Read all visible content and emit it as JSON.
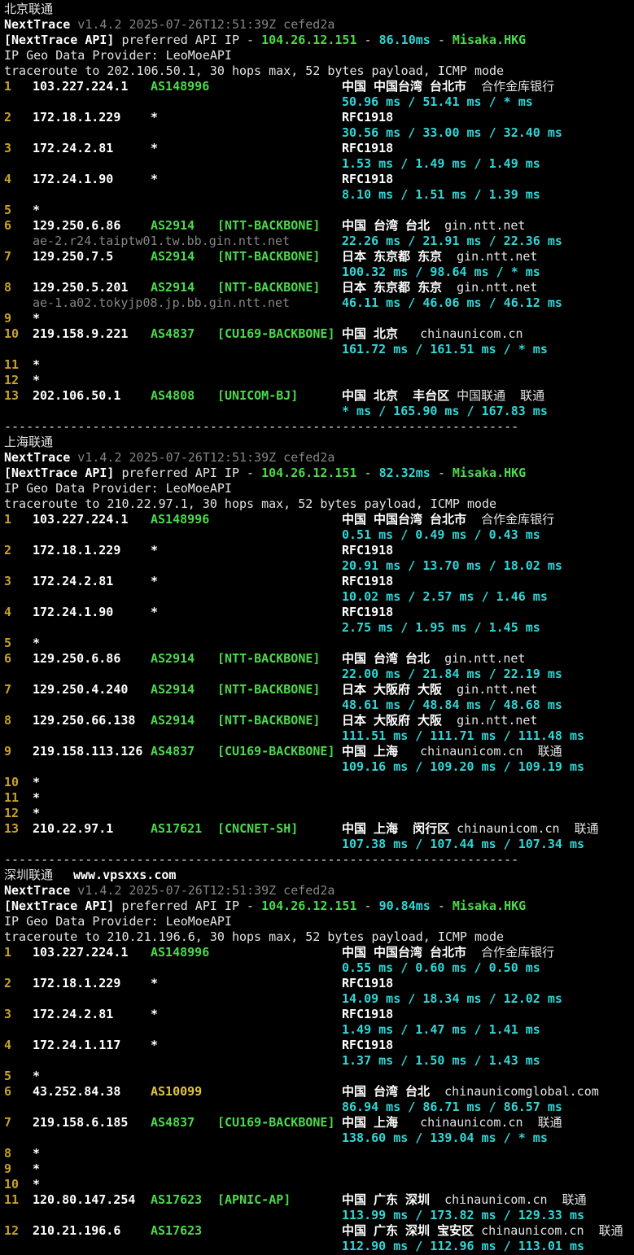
{
  "palette": {
    "background": "#000000",
    "text": "#e4e4e4",
    "text_bold": "#ffffff",
    "green": "#4cda4c",
    "cyan": "#31d6d6",
    "yellow": "#c9a22a",
    "yellow_bright": "#e2c53a",
    "gray": "#858585"
  },
  "sections": [
    {
      "title": "北京联通",
      "watermark": "",
      "app_name": "NextTrace",
      "version": " v1.4.2 2025-07-26T12:51:39Z cefed2a",
      "api": {
        "label": "[NextTrace API]",
        "pre": " preferred API IP - ",
        "ip": "104.26.12.151",
        "sep1": " - ",
        "latency": "86.10ms",
        "sep2": " - ",
        "node": "Misaka.HKG"
      },
      "provider_line": "IP Geo Data Provider: LeoMoeAPI",
      "trace_line": "traceroute to 202.106.50.1, 30 hops max, 52 bytes payload, ICMP mode",
      "separator": "----------------------------------------------------------------------",
      "hops": [
        {
          "n": "1",
          "ip": "103.227.224.1",
          "asn": "AS148996",
          "asn_c": "g",
          "tag": "",
          "loc": [
            {
              "t": "中国 中国台湾 台北市",
              "s": "b"
            },
            {
              "t": "  合作金库银行",
              "s": "w"
            }
          ],
          "host": "",
          "lat": "50.96 ms / 51.41 ms / * ms"
        },
        {
          "n": "2",
          "ip": "172.18.1.229",
          "asn": "*",
          "asn_c": "b",
          "tag": "",
          "loc": [
            {
              "t": "RFC1918",
              "s": "b"
            }
          ],
          "host": "",
          "lat": "30.56 ms / 33.00 ms / 32.40 ms"
        },
        {
          "n": "3",
          "ip": "172.24.2.81",
          "asn": "*",
          "asn_c": "b",
          "tag": "",
          "loc": [
            {
              "t": "RFC1918",
              "s": "b"
            }
          ],
          "host": "",
          "lat": "1.53 ms / 1.49 ms / 1.49 ms"
        },
        {
          "n": "4",
          "ip": "172.24.1.90",
          "asn": "*",
          "asn_c": "b",
          "tag": "",
          "loc": [
            {
              "t": "RFC1918",
              "s": "b"
            }
          ],
          "host": "",
          "lat": "8.10 ms / 1.51 ms / 1.39 ms"
        },
        {
          "n": "5",
          "ip": "*"
        },
        {
          "n": "6",
          "ip": "129.250.6.86",
          "asn": "AS2914",
          "asn_c": "g",
          "tag": "[NTT-BACKBONE]",
          "loc": [
            {
              "t": "中国 台湾 台北",
              "s": "b"
            },
            {
              "t": "  gin.ntt.net",
              "s": "w"
            }
          ],
          "host": "ae-2.r24.taiptw01.tw.bb.gin.ntt.net",
          "lat": "22.26 ms / 21.91 ms / 22.36 ms"
        },
        {
          "n": "7",
          "ip": "129.250.7.5",
          "asn": "AS2914",
          "asn_c": "g",
          "tag": "[NTT-BACKBONE]",
          "loc": [
            {
              "t": "日本 东京都 东京",
              "s": "b"
            },
            {
              "t": "  gin.ntt.net",
              "s": "w"
            }
          ],
          "host": "",
          "lat": "100.32 ms / 98.64 ms / * ms"
        },
        {
          "n": "8",
          "ip": "129.250.5.201",
          "asn": "AS2914",
          "asn_c": "g",
          "tag": "[NTT-BACKBONE]",
          "loc": [
            {
              "t": "日本 东京都 东京",
              "s": "b"
            },
            {
              "t": "  gin.ntt.net",
              "s": "w"
            }
          ],
          "host": "ae-1.a02.tokyjp08.jp.bb.gin.ntt.net",
          "lat": "46.11 ms / 46.06 ms / 46.12 ms"
        },
        {
          "n": "9",
          "ip": "*"
        },
        {
          "n": "10",
          "ip": "219.158.9.221",
          "asn": "AS4837",
          "asn_c": "g",
          "tag": "[CU169-BACKBONE]",
          "loc": [
            {
              "t": "中国 北京",
              "s": "b"
            },
            {
              "t": "   chinaunicom.cn",
              "s": "w"
            }
          ],
          "host": "",
          "lat": "161.72 ms / 161.51 ms / * ms"
        },
        {
          "n": "11",
          "ip": "*"
        },
        {
          "n": "12",
          "ip": "*"
        },
        {
          "n": "13",
          "ip": "202.106.50.1",
          "asn": "AS4808",
          "asn_c": "g",
          "tag": "[UNICOM-BJ]",
          "loc": [
            {
              "t": "中国 北京  丰台区",
              "s": "b"
            },
            {
              "t": " 中国联通  联通",
              "s": "w"
            }
          ],
          "host": "",
          "lat": "* ms / 165.90 ms / 167.83 ms"
        }
      ]
    },
    {
      "title": "上海联通",
      "watermark": "",
      "app_name": "NextTrace",
      "version": " v1.4.2 2025-07-26T12:51:39Z cefed2a",
      "api": {
        "label": "[NextTrace API]",
        "pre": " preferred API IP - ",
        "ip": "104.26.12.151",
        "sep1": " - ",
        "latency": "82.32ms",
        "sep2": " - ",
        "node": "Misaka.HKG"
      },
      "provider_line": "IP Geo Data Provider: LeoMoeAPI",
      "trace_line": "traceroute to 210.22.97.1, 30 hops max, 52 bytes payload, ICMP mode",
      "separator": "----------------------------------------------------------------------",
      "hops": [
        {
          "n": "1",
          "ip": "103.227.224.1",
          "asn": "AS148996",
          "asn_c": "g",
          "tag": "",
          "loc": [
            {
              "t": "中国 中国台湾 台北市",
              "s": "b"
            },
            {
              "t": "  合作金库银行",
              "s": "w"
            }
          ],
          "host": "",
          "lat": "0.51 ms / 0.49 ms / 0.43 ms"
        },
        {
          "n": "2",
          "ip": "172.18.1.229",
          "asn": "*",
          "asn_c": "b",
          "tag": "",
          "loc": [
            {
              "t": "RFC1918",
              "s": "b"
            }
          ],
          "host": "",
          "lat": "20.91 ms / 13.70 ms / 18.02 ms"
        },
        {
          "n": "3",
          "ip": "172.24.2.81",
          "asn": "*",
          "asn_c": "b",
          "tag": "",
          "loc": [
            {
              "t": "RFC1918",
              "s": "b"
            }
          ],
          "host": "",
          "lat": "10.02 ms / 2.57 ms / 1.46 ms"
        },
        {
          "n": "4",
          "ip": "172.24.1.90",
          "asn": "*",
          "asn_c": "b",
          "tag": "",
          "loc": [
            {
              "t": "RFC1918",
              "s": "b"
            }
          ],
          "host": "",
          "lat": "2.75 ms / 1.95 ms / 1.45 ms"
        },
        {
          "n": "5",
          "ip": "*"
        },
        {
          "n": "6",
          "ip": "129.250.6.86",
          "asn": "AS2914",
          "asn_c": "g",
          "tag": "[NTT-BACKBONE]",
          "loc": [
            {
              "t": "中国 台湾 台北",
              "s": "b"
            },
            {
              "t": "  gin.ntt.net",
              "s": "w"
            }
          ],
          "host": "",
          "lat": "22.00 ms / 21.84 ms / 22.19 ms"
        },
        {
          "n": "7",
          "ip": "129.250.4.240",
          "asn": "AS2914",
          "asn_c": "g",
          "tag": "[NTT-BACKBONE]",
          "loc": [
            {
              "t": "日本 大阪府 大阪",
              "s": "b"
            },
            {
              "t": "  gin.ntt.net",
              "s": "w"
            }
          ],
          "host": "",
          "lat": "48.61 ms / 48.84 ms / 48.68 ms"
        },
        {
          "n": "8",
          "ip": "129.250.66.138",
          "asn": "AS2914",
          "asn_c": "g",
          "tag": "[NTT-BACKBONE]",
          "loc": [
            {
              "t": "日本 大阪府 大阪",
              "s": "b"
            },
            {
              "t": "  gin.ntt.net",
              "s": "w"
            }
          ],
          "host": "",
          "lat": "111.51 ms / 111.71 ms / 111.48 ms"
        },
        {
          "n": "9",
          "ip": "219.158.113.126",
          "asn": "AS4837",
          "asn_c": "g",
          "tag": "[CU169-BACKBONE]",
          "loc": [
            {
              "t": "中国 上海",
              "s": "b"
            },
            {
              "t": "   chinaunicom.cn  联通",
              "s": "w"
            }
          ],
          "host": "",
          "lat": "109.16 ms / 109.20 ms / 109.19 ms"
        },
        {
          "n": "10",
          "ip": "*"
        },
        {
          "n": "11",
          "ip": "*"
        },
        {
          "n": "12",
          "ip": "*"
        },
        {
          "n": "13",
          "ip": "210.22.97.1",
          "asn": "AS17621",
          "asn_c": "g",
          "tag": "[CNCNET-SH]",
          "loc": [
            {
              "t": "中国 上海  闵行区",
              "s": "b"
            },
            {
              "t": " chinaunicom.cn  联通",
              "s": "w"
            }
          ],
          "host": "",
          "lat": "107.38 ms / 107.44 ms / 107.34 ms"
        }
      ]
    },
    {
      "title": "深圳联通",
      "watermark": "www.vpsxxs.com",
      "app_name": "NextTrace",
      "version": " v1.4.2 2025-07-26T12:51:39Z cefed2a",
      "api": {
        "label": "[NextTrace API]",
        "pre": " preferred API IP - ",
        "ip": "104.26.12.151",
        "sep1": " - ",
        "latency": "90.84ms",
        "sep2": " - ",
        "node": "Misaka.HKG"
      },
      "provider_line": "IP Geo Data Provider: LeoMoeAPI",
      "trace_line": "traceroute to 210.21.196.6, 30 hops max, 52 bytes payload, ICMP mode",
      "separator": "",
      "hops": [
        {
          "n": "1",
          "ip": "103.227.224.1",
          "asn": "AS148996",
          "asn_c": "g",
          "tag": "",
          "loc": [
            {
              "t": "中国 中国台湾 台北市",
              "s": "b"
            },
            {
              "t": "  合作金库银行",
              "s": "w"
            }
          ],
          "host": "",
          "lat": "0.55 ms / 0.60 ms / 0.50 ms"
        },
        {
          "n": "2",
          "ip": "172.18.1.229",
          "asn": "*",
          "asn_c": "b",
          "tag": "",
          "loc": [
            {
              "t": "RFC1918",
              "s": "b"
            }
          ],
          "host": "",
          "lat": "14.09 ms / 18.34 ms / 12.02 ms"
        },
        {
          "n": "3",
          "ip": "172.24.2.81",
          "asn": "*",
          "asn_c": "b",
          "tag": "",
          "loc": [
            {
              "t": "RFC1918",
              "s": "b"
            }
          ],
          "host": "",
          "lat": "1.49 ms / 1.47 ms / 1.41 ms"
        },
        {
          "n": "4",
          "ip": "172.24.1.117",
          "asn": "*",
          "asn_c": "b",
          "tag": "",
          "loc": [
            {
              "t": "RFC1918",
              "s": "b"
            }
          ],
          "host": "",
          "lat": "1.37 ms / 1.50 ms / 1.43 ms"
        },
        {
          "n": "5",
          "ip": "*"
        },
        {
          "n": "6",
          "ip": "43.252.84.38",
          "asn": "AS10099",
          "asn_c": "y",
          "tag": "",
          "loc": [
            {
              "t": "中国 台湾 台北",
              "s": "b"
            },
            {
              "t": "  chinaunicomglobal.com",
              "s": "w"
            }
          ],
          "host": "",
          "lat": "86.94 ms / 86.71 ms / 86.57 ms"
        },
        {
          "n": "7",
          "ip": "219.158.6.185",
          "asn": "AS4837",
          "asn_c": "g",
          "tag": "[CU169-BACKBONE]",
          "loc": [
            {
              "t": "中国 上海",
              "s": "b"
            },
            {
              "t": "   chinaunicom.cn  联通",
              "s": "w"
            }
          ],
          "host": "",
          "lat": "138.60 ms / 139.04 ms / * ms"
        },
        {
          "n": "8",
          "ip": "*"
        },
        {
          "n": "9",
          "ip": "*"
        },
        {
          "n": "10",
          "ip": "*"
        },
        {
          "n": "11",
          "ip": "120.80.147.254",
          "asn": "AS17623",
          "asn_c": "g",
          "tag": "[APNIC-AP]",
          "loc": [
            {
              "t": "中国 广东 深圳",
              "s": "b"
            },
            {
              "t": "  chinaunicom.cn  联通",
              "s": "w"
            }
          ],
          "host": "",
          "lat": "113.99 ms / 173.82 ms / 129.33 ms"
        },
        {
          "n": "12",
          "ip": "210.21.196.6",
          "asn": "AS17623",
          "asn_c": "g",
          "tag": "",
          "loc": [
            {
              "t": "中国 广东 深圳 宝安区",
              "s": "b"
            },
            {
              "t": " chinaunicom.cn  联通",
              "s": "w"
            }
          ],
          "host": "",
          "lat": "112.90 ms / 112.96 ms / 113.01 ms"
        }
      ]
    }
  ]
}
